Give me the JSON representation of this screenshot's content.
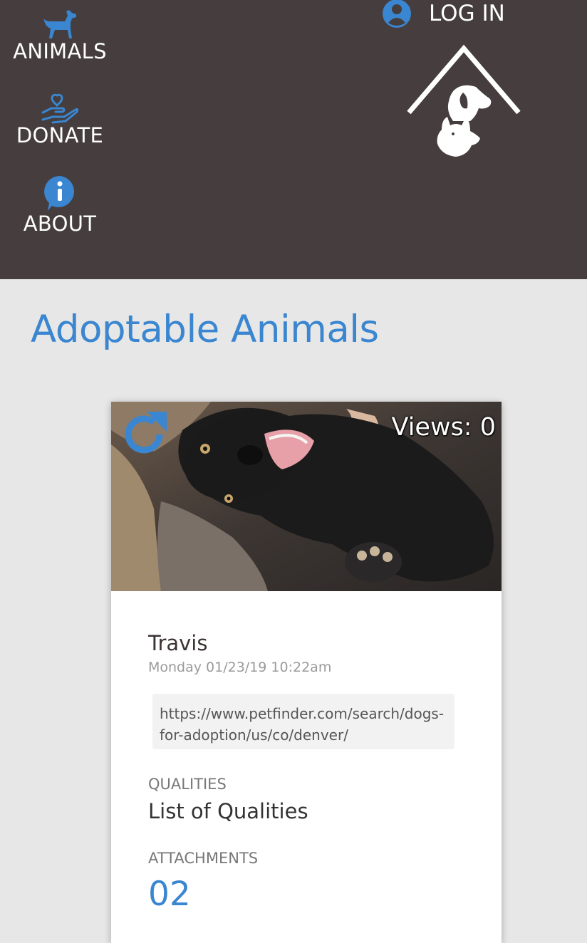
{
  "nav": {
    "items": [
      {
        "label": "ANIMALS",
        "icon": "dog-icon"
      },
      {
        "label": "DONATE",
        "icon": "heart-hand-icon"
      },
      {
        "label": "ABOUT",
        "icon": "info-icon"
      }
    ],
    "login_label": "LOG IN",
    "login_icon": "user-circle-icon"
  },
  "page": {
    "title": "Adoptable Animals"
  },
  "card": {
    "views_label": "Views: 0",
    "name": "Travis",
    "date": "Monday 01/23/19 10:22am",
    "url": "https://www.petfinder.com/search/dogs-for-adoption/us/co/denver/",
    "qualities_label": "QUALITIES",
    "qualities_value": "List of Qualities",
    "attachments_label": "ATTACHMENTS",
    "attachments_value": "02"
  },
  "colors": {
    "header_bg": "#453d3e",
    "accent": "#3a86d0",
    "page_bg": "#e7e7e7"
  }
}
